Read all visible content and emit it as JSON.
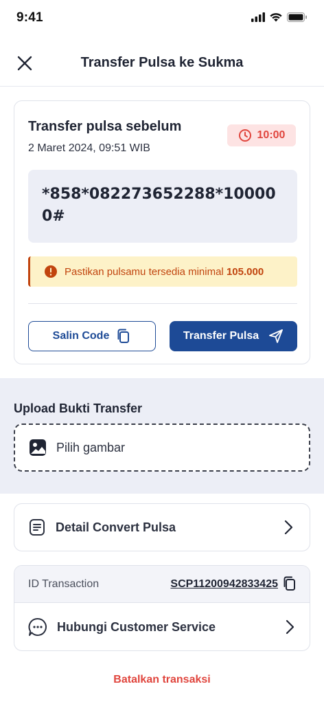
{
  "status_bar": {
    "time": "9:41"
  },
  "header": {
    "title": "Transfer Pulsa ke Sukma"
  },
  "card": {
    "title": "Transfer pulsa sebelum",
    "date": "2 Maret 2024, 09:51 WIB",
    "timer": "10:00",
    "code": "*858*082273652288*100000#",
    "warning_text": "Pastikan pulsamu tersedia minimal",
    "warning_amount": "105.000",
    "copy_button": "Salin Code",
    "transfer_button": "Transfer Pulsa"
  },
  "upload": {
    "title": "Upload Bukti Transfer",
    "placeholder": "Pilih gambar"
  },
  "detail": {
    "label": "Detail Convert Pulsa"
  },
  "transaction": {
    "id_label": "ID Transaction",
    "id_value": "SCP11200942833425",
    "cs_label": "Hubungi Customer Service"
  },
  "cancel": {
    "label": "Batalkan transaksi"
  },
  "colors": {
    "primary": "#1d4a96",
    "danger": "#e0453d",
    "warning_bg": "#fdf2c8",
    "warning_text": "#c1440e",
    "surface": "#eceef6"
  },
  "icons": {
    "close": "close-icon",
    "timer": "clock-icon",
    "warning": "alert-circle-icon",
    "copy": "copy-icon",
    "send": "send-icon",
    "image": "image-icon",
    "document": "document-icon",
    "chat": "chat-icon",
    "chevron": "chevron-right-icon"
  }
}
